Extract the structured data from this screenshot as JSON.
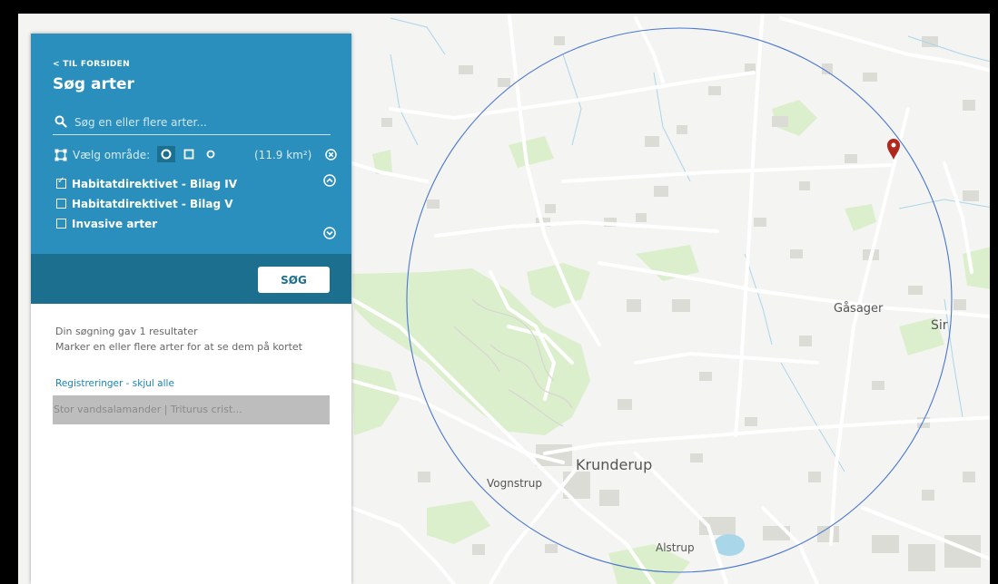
{
  "panel": {
    "back_link": "< TIL FORSIDEN",
    "title": "Søg arter",
    "search": {
      "placeholder": "Søg en eller flere arter...",
      "value": ""
    },
    "area": {
      "label": "Vælg område:",
      "shapes": [
        "circle",
        "square",
        "circle-outline"
      ],
      "selected_shape": "circle",
      "size": "(11.9 km²)"
    },
    "checkboxes": [
      {
        "label": "Habitatdirektivet - Bilag IV",
        "checked": true
      },
      {
        "label": "Habitatdirektivet - Bilag V",
        "checked": false
      },
      {
        "label": "Invasive arter",
        "checked": false
      }
    ],
    "search_button": "SØG",
    "results": {
      "line1": "Din søgning gav 1 resultater",
      "line2": "Marker en eller flere arter for at se dem på kortet"
    },
    "registrations_link": "Registreringer - skjul alle",
    "species": [
      "Stor vandsalamander | Triturus crist..."
    ]
  },
  "map": {
    "place_labels": [
      "Gåsager",
      "Sir",
      "Krunderup",
      "Vognstrup",
      "Alstrup"
    ],
    "circle_color": "#4a77d0",
    "marker_color": "#b1271b",
    "colors": {
      "background": "#f4f4f2",
      "green": "#dff0d0",
      "roads": "#ffffff",
      "buildings": "#dcdcd6",
      "water": "#aad6ea"
    }
  }
}
